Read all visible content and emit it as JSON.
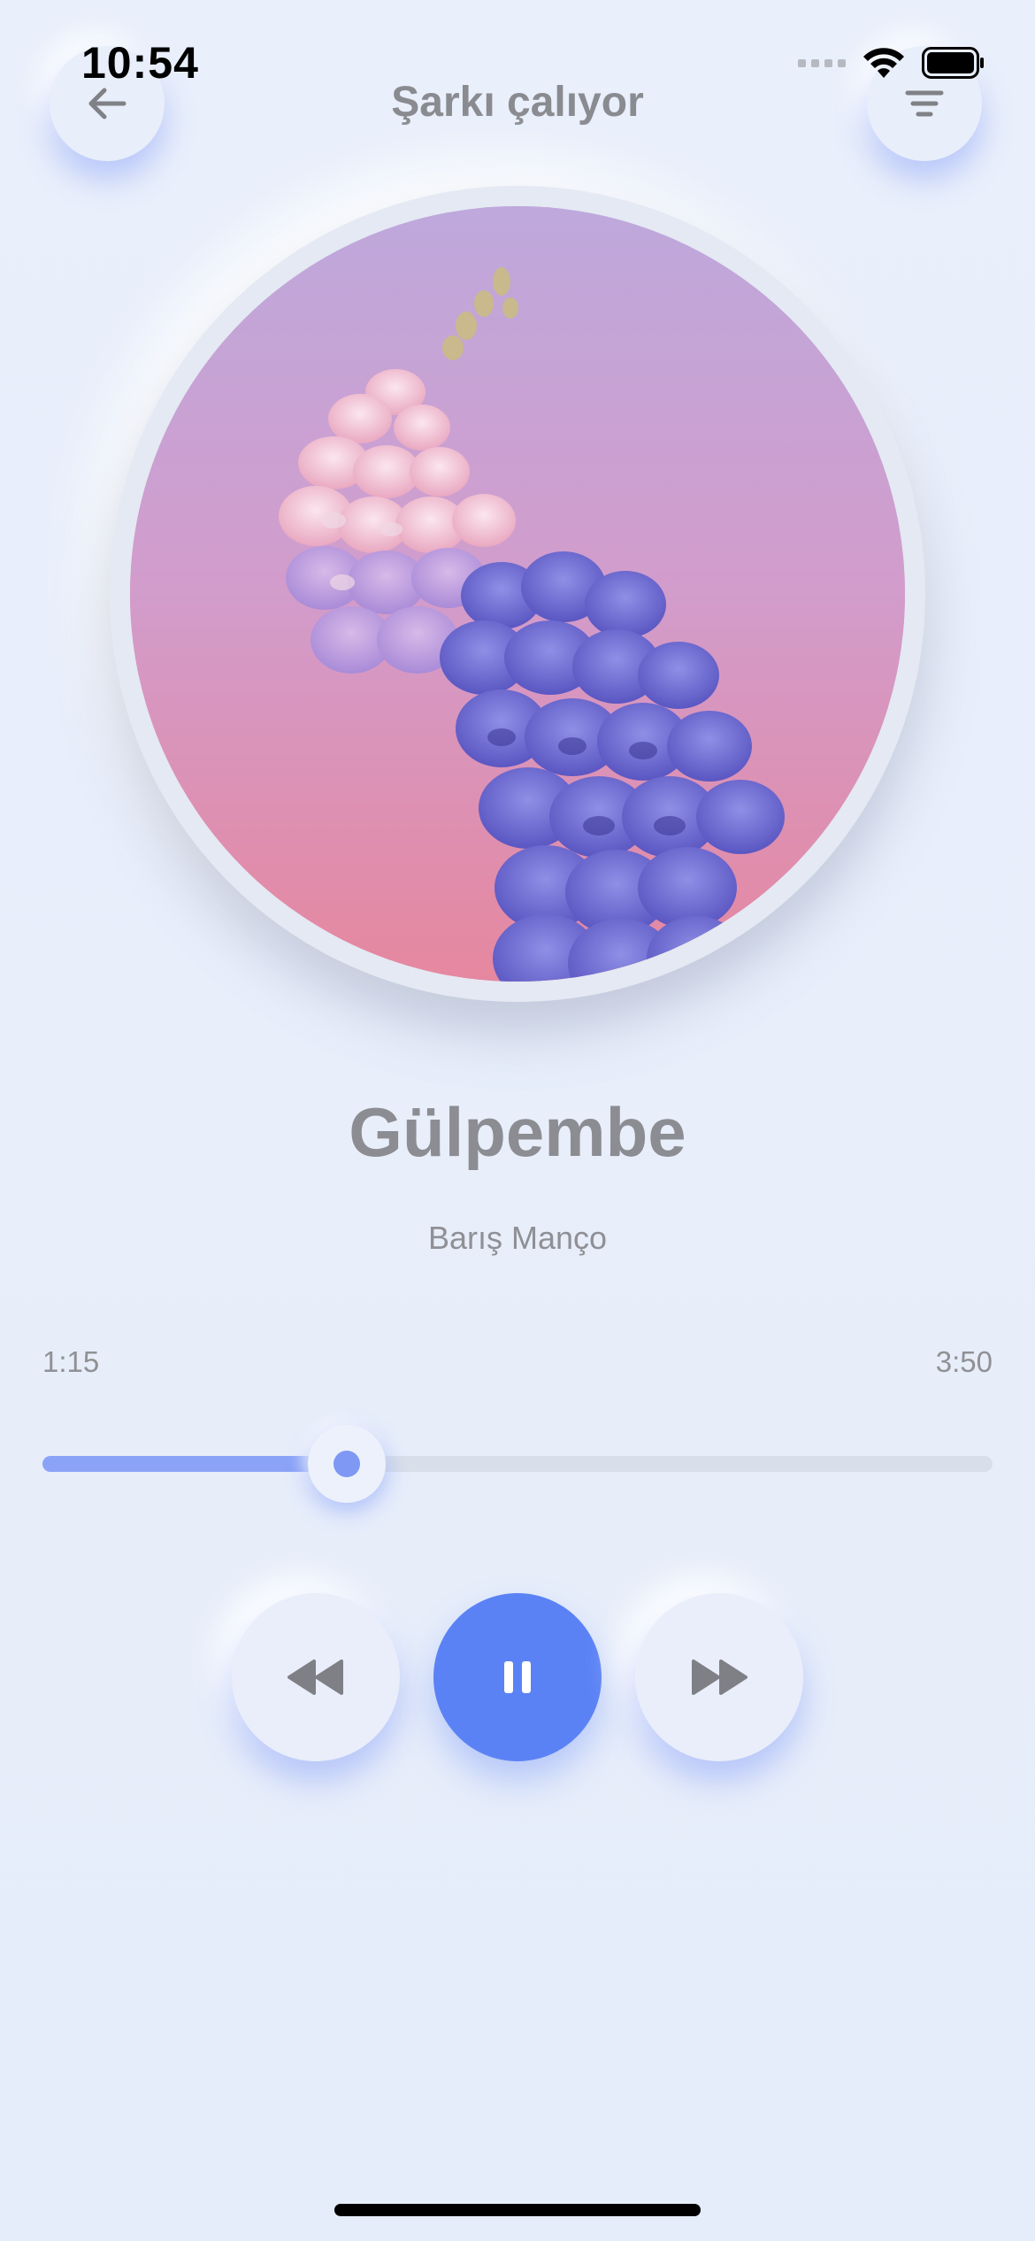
{
  "status_bar": {
    "time": "10:54"
  },
  "header": {
    "title": "Şarkı çalıyor",
    "back_icon": "arrow-left-icon",
    "menu_icon": "menu-lines-icon"
  },
  "now_playing": {
    "title": "Gülpembe",
    "artist": "Barış Manço",
    "elapsed": "1:15",
    "duration": "3:50",
    "progress_fraction": 0.32
  },
  "controls": {
    "rewind_icon": "rewind-icon",
    "play_pause_icon": "pause-icon",
    "forward_icon": "fast-forward-icon"
  },
  "colors": {
    "accent": "#5b82f5",
    "progress_fill": "#8ba3f7",
    "background": "#e8eefa",
    "muted_text": "#8c8d92"
  }
}
